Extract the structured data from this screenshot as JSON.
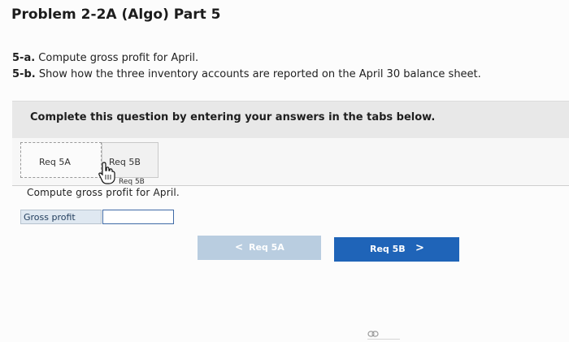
{
  "header": {
    "title": "Problem 2-2A (Algo) Part 5"
  },
  "questions": [
    {
      "number": "5-a.",
      "text": " Compute gross profit for April."
    },
    {
      "number": "5-b.",
      "text": " Show how the three inventory accounts are reported on the April 30 balance sheet."
    }
  ],
  "instructions": "Complete this question by entering your answers in the tabs below.",
  "tabs": [
    {
      "label": "Req 5A"
    },
    {
      "label": "Req 5B"
    }
  ],
  "tooltip": "Req 5B",
  "prompt": "Compute gross profit for April.",
  "form": {
    "gross_profit_label": "Gross profit",
    "gross_profit_value": ""
  },
  "nav": {
    "prev_label": "Req 5A",
    "prev_icon": "<",
    "next_label": "Req 5B",
    "next_icon": ">"
  },
  "colors": {
    "next_button": "#1f64b8",
    "prev_button_disabled": "#b9cde0",
    "label_cell": "#dfe8f1"
  },
  "icons": [
    "hand-pointer-cursor-icon",
    "link-icon"
  ]
}
